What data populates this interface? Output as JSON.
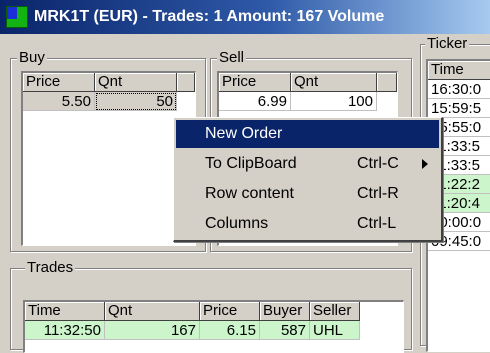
{
  "window": {
    "title": "MRK1T (EUR) - Trades: 1  Amount: 167  Volume"
  },
  "buy": {
    "label": "Buy",
    "columns": [
      "Price",
      "Qnt"
    ],
    "rows": [
      {
        "price": "5.50",
        "qnt": "50"
      }
    ]
  },
  "sell": {
    "label": "Sell",
    "columns": [
      "Price",
      "Qnt"
    ],
    "rows": [
      {
        "price": "6.99",
        "qnt": "100"
      }
    ]
  },
  "ticker": {
    "label": "Ticker",
    "columns": [
      "Time"
    ],
    "rows": [
      "16:30:0",
      "15:59:5",
      "15:55:0",
      "11:33:5",
      "11:33:5",
      "11:22:2",
      "11:20:4",
      "10:00:0",
      "09:45:0"
    ],
    "row_colors": [
      "#ffffff",
      "#ffffff",
      "#ffffff",
      "#ffffff",
      "#ffffff",
      "#ccf5cc",
      "#ccf5cc",
      "#ffffff",
      "#ffffff"
    ]
  },
  "trades": {
    "label": "Trades",
    "columns": [
      "Time",
      "Qnt",
      "Price",
      "Buyer",
      "Seller"
    ],
    "rows": [
      {
        "time": "11:32:50",
        "qnt": "167",
        "price": "6.15",
        "buyer": "587",
        "seller": "UHL"
      }
    ]
  },
  "context_menu": {
    "items": [
      {
        "label": "New Order",
        "shortcut": "",
        "submenu": false,
        "highlighted": true
      },
      {
        "label": "To ClipBoard",
        "shortcut": "Ctrl-C",
        "submenu": true,
        "highlighted": false
      },
      {
        "label": "Row content",
        "shortcut": "Ctrl-R",
        "submenu": false,
        "highlighted": false
      },
      {
        "label": "Columns",
        "shortcut": "Ctrl-L",
        "submenu": false,
        "highlighted": false
      }
    ]
  },
  "colors": {
    "highlight": "#0a246a",
    "title_start": "#0a246a",
    "title_end": "#a6caf0",
    "green_row": "#ccf5cc"
  }
}
